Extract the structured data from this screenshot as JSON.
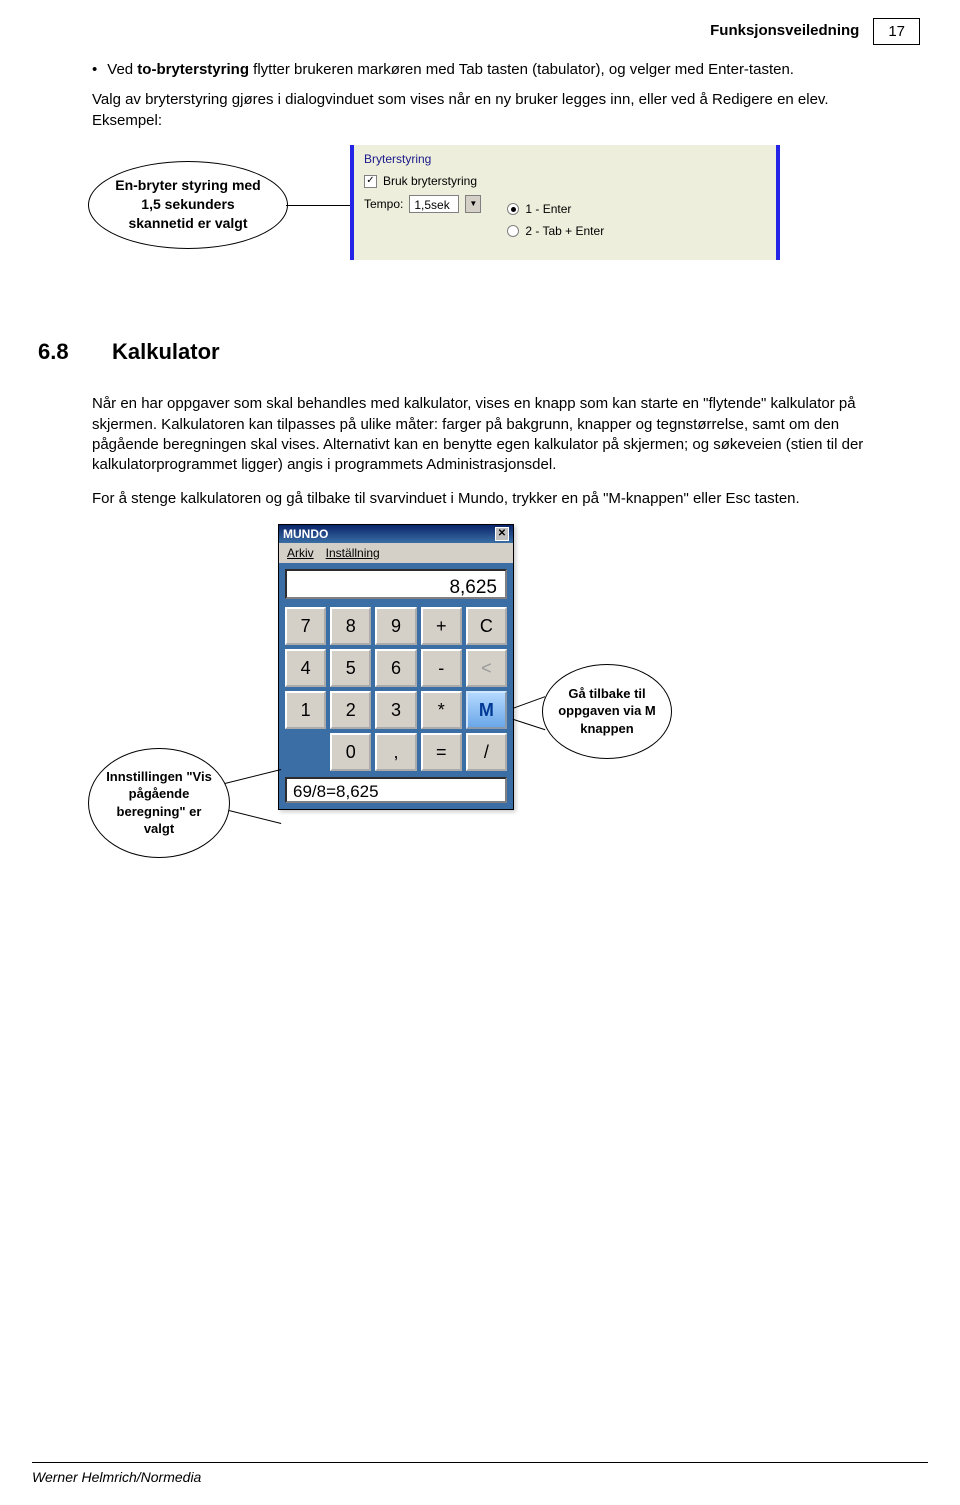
{
  "header": {
    "title": "Funksjonsveiledning",
    "page": "17"
  },
  "footer": {
    "author": "Werner Helmrich/Normedia"
  },
  "bullet1": {
    "prefix": "Ved ",
    "bold": "to-bryterstyring",
    "rest": " flytter brukeren markøren med Tab tasten (tabulator), og velger med Enter-tasten."
  },
  "para1": "Valg av bryterstyring gjøres i dialogvinduet som vises når en ny bruker legges inn, eller ved å Redigere en elev. Eksempel:",
  "fig1": {
    "callout1": "En-bryter styring med 1,5 sekunders skannetid er valgt",
    "groupLabel": "Bryterstyring",
    "chkLabel": "Bruk bryterstyring",
    "tempoLabel": "Tempo:",
    "tempoValue": "1,5sek",
    "radio1": "1 - Enter",
    "radio2": "2 - Tab + Enter"
  },
  "section": {
    "num": "6.8",
    "title": "Kalkulator"
  },
  "para2": "Når en har oppgaver som skal behandles med kalkulator, vises en knapp som kan starte en \"flytende\" kalkulator på skjermen. Kalkulatoren kan tilpasses på ulike måter: farger på bakgrunn, knapper og tegnstørrelse, samt om den pågående beregningen skal vises. Alternativt kan en benytte egen kalkulator på skjermen; og søkeveien (stien til der kalkulatorprogrammet ligger) angis i programmets Administrasjonsdel.",
  "para3": "For å stenge kalkulatoren og gå tilbake til svarvinduet i Mundo, trykker en på \"M-knappen\" eller Esc tasten.",
  "calc": {
    "title": "MUNDO",
    "menu1": "Arkiv",
    "menu2": "Inställning",
    "display": "8,625",
    "buttons": {
      "r1": [
        "7",
        "8",
        "9",
        "+",
        "C"
      ],
      "r2": [
        "4",
        "5",
        "6",
        "-",
        "<"
      ],
      "r3": [
        "1",
        "2",
        "3",
        "*",
        "M"
      ],
      "r4": [
        "0",
        ",",
        "=",
        "/"
      ]
    },
    "running": "69/8=8,625"
  },
  "callout2": "Gå tilbake til oppgaven via M knappen",
  "callout3": "Innstillingen \"Vis pågående beregning\" er valgt"
}
